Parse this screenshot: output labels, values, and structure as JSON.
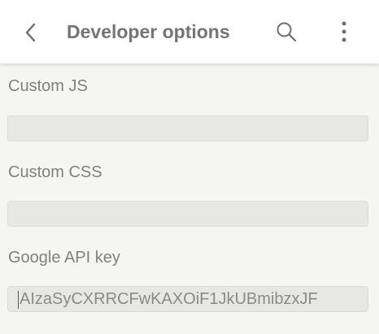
{
  "toolbar": {
    "title": "Developer options",
    "back_icon": "chevron-left-icon",
    "search_icon": "search-icon",
    "more_icon": "more-vertical-icon"
  },
  "settings": {
    "custom_js": {
      "label": "Custom JS",
      "value": ""
    },
    "custom_css": {
      "label": "Custom CSS",
      "value": ""
    },
    "google_api_key": {
      "label": "Google API key",
      "value": "AIzaSyCXRRCFwKAXOiF1JkUBmibzxJF"
    }
  },
  "colors": {
    "background": "#f5f5f2",
    "toolbar": "#ffffff",
    "field": "#e8e8e3",
    "text_muted": "#808080"
  }
}
